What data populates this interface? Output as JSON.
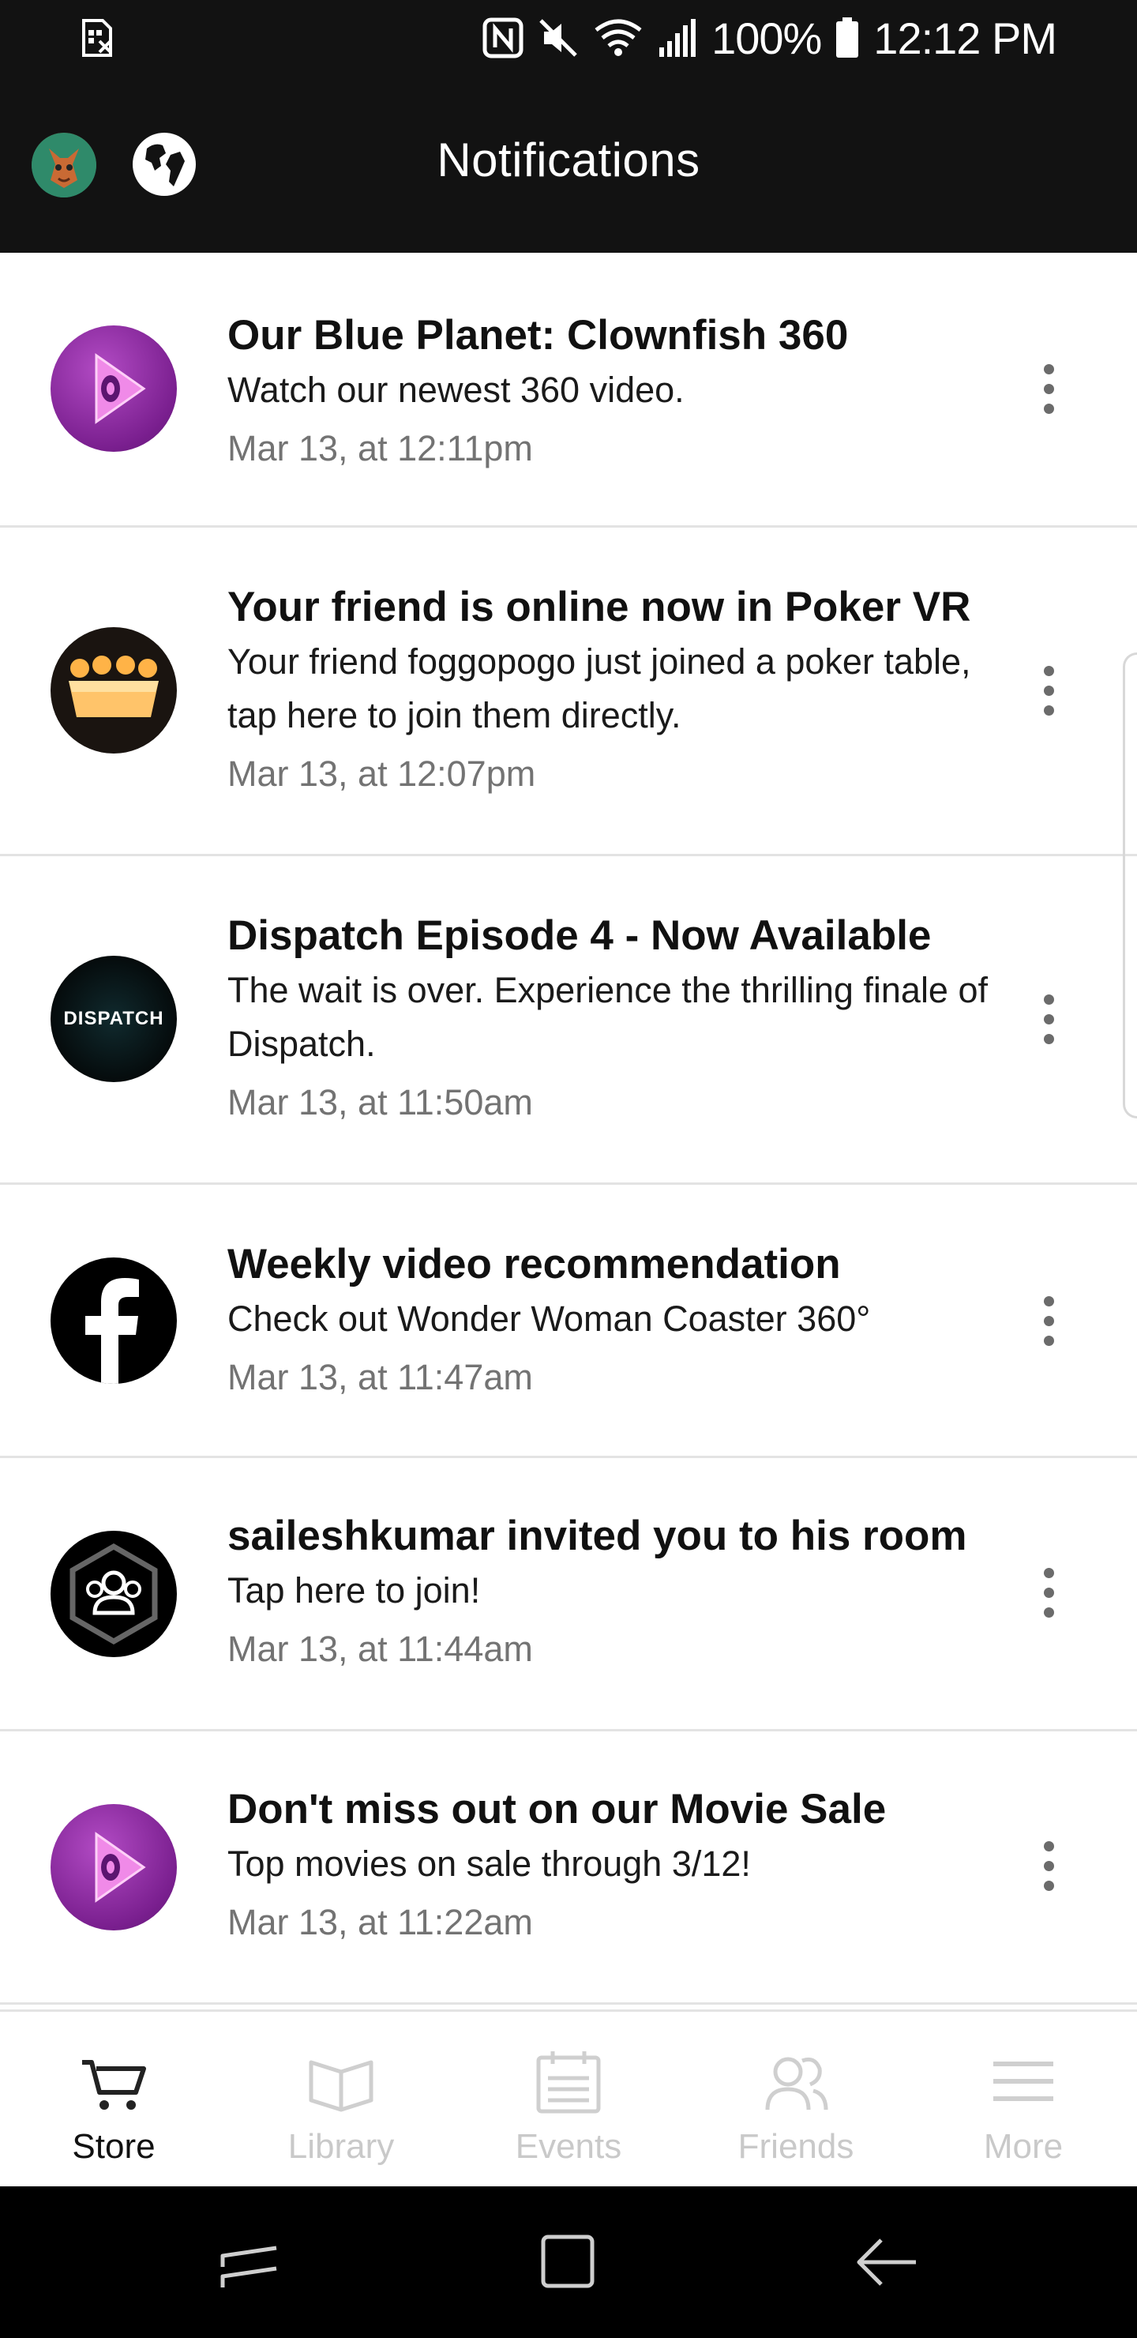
{
  "status_bar": {
    "battery": "100%",
    "time": "12:12 PM"
  },
  "app_bar": {
    "title": "Notifications"
  },
  "notifications": [
    {
      "icon": "oculus-video-icon",
      "title": "Our Blue Planet: Clownfish 360",
      "body": "Watch our newest 360 video.",
      "time": "Mar 13, at 12:11pm"
    },
    {
      "icon": "poker-crown-icon",
      "title": "Your friend is online now in Poker VR",
      "body": "Your friend foggopogo just joined a poker table, tap here to join them directly.",
      "time": "Mar 13, at 12:07pm"
    },
    {
      "icon": "dispatch-logo",
      "icon_text": "DISPATCH",
      "title": "Dispatch Episode 4 - Now Available",
      "body": "The wait is over. Experience the thrilling finale of Dispatch.",
      "time": "Mar 13, at 11:50am"
    },
    {
      "icon": "facebook-icon",
      "title": "Weekly video recommendation",
      "body": "Check out Wonder Woman Coaster 360°",
      "time": "Mar 13, at 11:47am"
    },
    {
      "icon": "rooms-icon",
      "title": "saileshkumar invited you to his room",
      "body": "Tap here to join!",
      "time": "Mar 13, at 11:44am"
    },
    {
      "icon": "oculus-video-icon",
      "title": "Don't miss out on our Movie Sale",
      "body": "Top movies on sale through 3/12!",
      "time": "Mar 13, at 11:22am"
    }
  ],
  "bottom_nav": {
    "tabs": [
      {
        "label": "Store",
        "icon": "cart-icon",
        "active": true
      },
      {
        "label": "Library",
        "icon": "book-icon",
        "active": false
      },
      {
        "label": "Events",
        "icon": "calendar-icon",
        "active": false
      },
      {
        "label": "Friends",
        "icon": "friends-icon",
        "active": false
      },
      {
        "label": "More",
        "icon": "hamburger-icon",
        "active": false
      }
    ]
  },
  "colors": {
    "header_bg": "#121212",
    "divider": "#e3e3e3",
    "timestamp": "#737373",
    "inactive_tab": "#c9c9c9"
  }
}
